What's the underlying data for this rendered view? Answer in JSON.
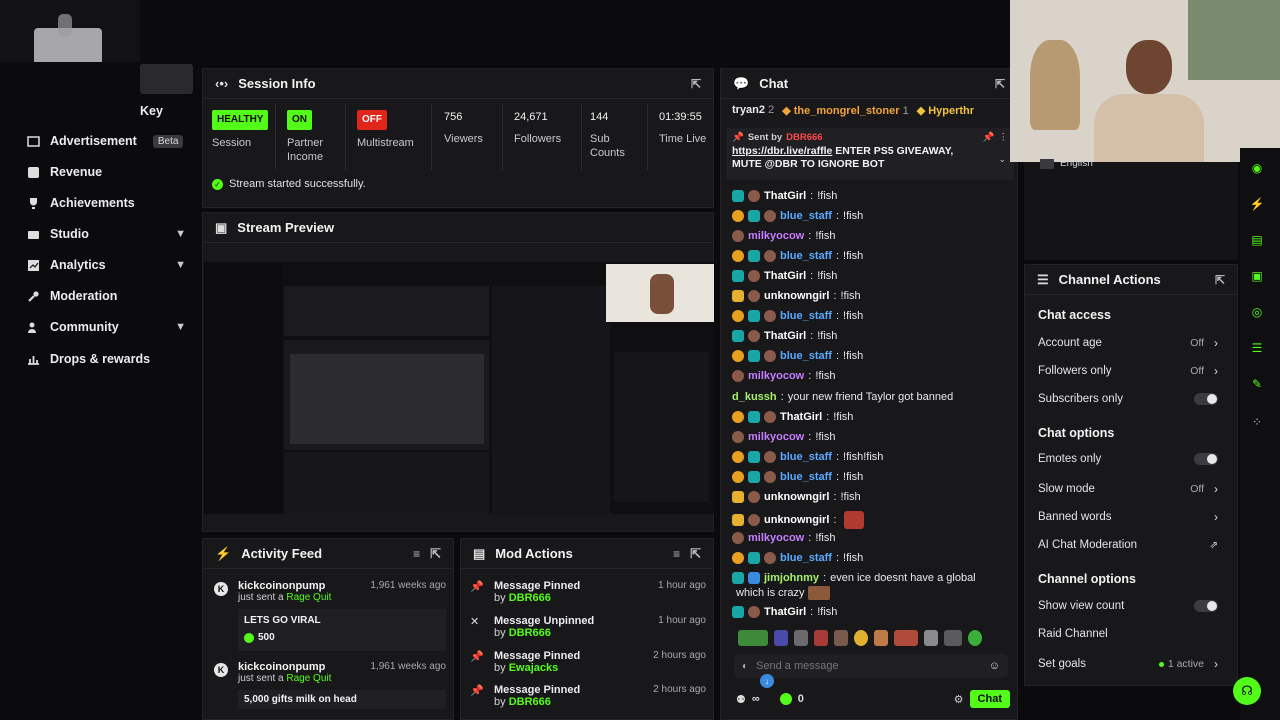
{
  "colors": {
    "accent": "#53fc18",
    "danger": "#e0261b",
    "panel": "#18181b",
    "bg": "#0b0b0d"
  },
  "sidebar": {
    "partial_item": "Key",
    "items": [
      {
        "label": "Advertisement",
        "icon": "megaphone-icon",
        "badge": "Beta"
      },
      {
        "label": "Revenue",
        "icon": "revenue-icon"
      },
      {
        "label": "Achievements",
        "icon": "trophy-icon"
      },
      {
        "label": "Studio",
        "icon": "studio-icon",
        "expandable": true
      },
      {
        "label": "Analytics",
        "icon": "analytics-icon",
        "expandable": true
      },
      {
        "label": "Moderation",
        "icon": "wrench-icon"
      },
      {
        "label": "Community",
        "icon": "community-icon",
        "expandable": true
      },
      {
        "label": "Drops & rewards",
        "icon": "drops-icon"
      }
    ]
  },
  "session": {
    "title": "Session Info",
    "stats": [
      {
        "badge": "HEALTHY",
        "label": "Session"
      },
      {
        "badge": "ON",
        "label": "Partner Income"
      },
      {
        "badge": "OFF",
        "label": "Multistream"
      },
      {
        "value": "756",
        "label": "Viewers"
      },
      {
        "value": "24,671",
        "label": "Followers"
      },
      {
        "value": "144",
        "label": "Sub Counts"
      },
      {
        "value": "01:39:55",
        "label": "Time Live"
      }
    ],
    "status_message": "Stream started successfully."
  },
  "preview": {
    "title": "Stream Preview"
  },
  "activity": {
    "title": "Activity Feed",
    "items": [
      {
        "user": "kickcoinonpump",
        "action": "just sent a",
        "item": "Rage Quit",
        "when": "1,961 weeks ago",
        "message": "LETS GO VIRAL",
        "amount": "500"
      },
      {
        "user": "kickcoinonpump",
        "action": "just sent a",
        "item": "Rage Quit",
        "when": "1,961 weeks ago",
        "message": "5,000 gifts milk on head"
      }
    ]
  },
  "mod": {
    "title": "Mod Actions",
    "items": [
      {
        "action": "Message Pinned",
        "by": "by",
        "user": "DBR666",
        "when": "1 hour ago"
      },
      {
        "action": "Message Unpinned",
        "by": "by",
        "user": "DBR666",
        "when": "1 hour ago"
      },
      {
        "action": "Message Pinned",
        "by": "by",
        "user": "Ewajacks",
        "when": "2 hours ago"
      },
      {
        "action": "Message Pinned",
        "by": "by",
        "user": "DBR666",
        "when": "2 hours ago"
      }
    ]
  },
  "chat": {
    "title": "Chat",
    "top_gifters": [
      {
        "name": "tryan2",
        "count": "2"
      },
      {
        "name": "the_mongrel_stoner",
        "count": "1"
      },
      {
        "name": "Hyperthr"
      }
    ],
    "pinned": {
      "sent_by": "Sent by",
      "user": "DBR666",
      "link": "https://dbr.live/raffle",
      "text": "ENTER PS5 GIVEAWAY, MUTE @DBR TO IGNORE BOT"
    },
    "messages": [
      {
        "user": "ThatGirl",
        "text": "!fish",
        "color": "#ffffff"
      },
      {
        "user": "blue_staff",
        "text": "!fish",
        "color": "#5aa9ff"
      },
      {
        "user": "milkyocow",
        "text": "!fish",
        "color": "#c77dff"
      },
      {
        "user": "blue_staff",
        "text": "!fish",
        "color": "#5aa9ff"
      },
      {
        "user": "ThatGirl",
        "text": "!fish",
        "color": "#ffffff"
      },
      {
        "user": "unknowngirl",
        "text": "!fish",
        "color": "#ffffff"
      },
      {
        "user": "blue_staff",
        "text": "!fish",
        "color": "#5aa9ff"
      },
      {
        "user": "ThatGirl",
        "text": "!fish",
        "color": "#ffffff"
      },
      {
        "user": "blue_staff",
        "text": "!fish",
        "color": "#5aa9ff"
      },
      {
        "user": "milkyocow",
        "text": "!fish",
        "color": "#c77dff"
      },
      {
        "user": "d_kussh",
        "text": "your new friend Taylor got banned",
        "color": "#a6f06a"
      },
      {
        "user": "ThatGirl",
        "text": "!fish",
        "color": "#ffffff"
      },
      {
        "user": "milkyocow",
        "text": "!fish",
        "color": "#c77dff"
      },
      {
        "user": "blue_staff",
        "text": "!fish!fish",
        "color": "#5aa9ff"
      },
      {
        "user": "blue_staff",
        "text": "!fish",
        "color": "#5aa9ff"
      },
      {
        "user": "unknowngirl",
        "text": "!fish",
        "color": "#ffffff"
      },
      {
        "user": "unknowngirl",
        "text": "",
        "color": "#ffffff"
      },
      {
        "user": "milkyocow",
        "text": "!fish",
        "color": "#c77dff"
      },
      {
        "user": "blue_staff",
        "text": "!fish",
        "color": "#5aa9ff"
      },
      {
        "user": "jimjohnmy",
        "text": "even ice doesnt have a global",
        "color": "#a6f06a"
      },
      {
        "user": "",
        "text": "which is crazy",
        "color": "#ffffff"
      },
      {
        "user": "ThatGirl",
        "text": "!fish",
        "color": "#ffffff"
      }
    ],
    "input_placeholder": "Send a message",
    "infinity": "∞",
    "points": "0",
    "send_label": "Chat"
  },
  "channel_actions": {
    "title": "Channel Actions",
    "language": "English",
    "sections": [
      {
        "title": "Chat access",
        "rows": [
          {
            "label": "Account age",
            "value": "Off",
            "type": "arrow"
          },
          {
            "label": "Followers only",
            "value": "Off",
            "type": "arrow"
          },
          {
            "label": "Subscribers only",
            "type": "toggle"
          }
        ]
      },
      {
        "title": "Chat options",
        "rows": [
          {
            "label": "Emotes only",
            "type": "toggle"
          },
          {
            "label": "Slow mode",
            "value": "Off",
            "type": "arrow"
          },
          {
            "label": "Banned words",
            "type": "arrow"
          },
          {
            "label": "AI Chat Moderation",
            "type": "external"
          }
        ]
      },
      {
        "title": "Channel options",
        "rows": [
          {
            "label": "Show view count",
            "type": "toggle"
          },
          {
            "label": "Raid Channel",
            "type": "none"
          },
          {
            "label": "Set goals",
            "value": "1 active",
            "type": "arrow"
          }
        ]
      }
    ]
  }
}
